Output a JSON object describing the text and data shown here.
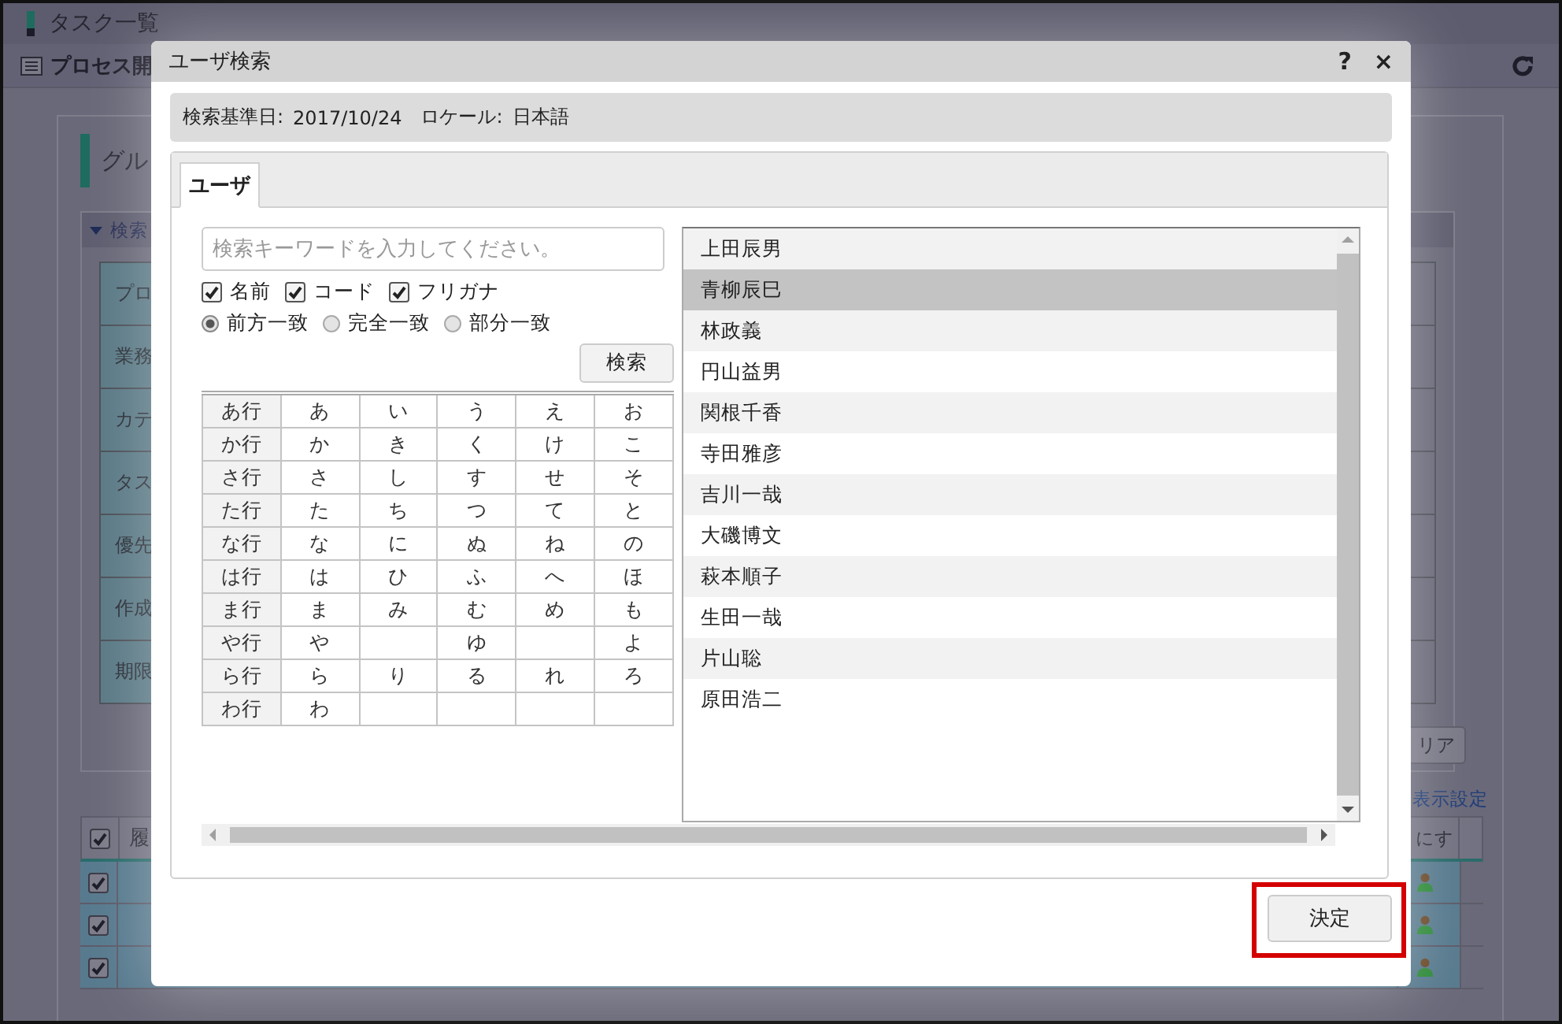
{
  "background_page": {
    "title": "タスク一覧",
    "subtitle": "プロセス開",
    "section_title": "グル",
    "search_header": "検索",
    "form_labels": [
      "プロ",
      "業務",
      "カテ",
      "タス",
      "優先",
      "作成",
      "期限"
    ],
    "clear_button": "リア",
    "display_settings_link": "表示設定",
    "table": {
      "header_checked": true,
      "columns": [
        "履",
        "にす"
      ],
      "rows": [
        {
          "checked": true
        },
        {
          "checked": true
        },
        {
          "checked": true
        }
      ]
    }
  },
  "dialog": {
    "title": "ユーザ検索",
    "help": "?",
    "close": "×",
    "info": [
      {
        "label": "検索基準日:",
        "value": "2017/10/24"
      },
      {
        "label": "ロケール:",
        "value": "日本語"
      }
    ],
    "tabs": [
      {
        "label": "ユーザ",
        "selected": true
      }
    ],
    "search": {
      "placeholder": "検索キーワードを入力してください。"
    },
    "targets": [
      {
        "label": "名前",
        "checked": true
      },
      {
        "label": "コード",
        "checked": true
      },
      {
        "label": "フリガナ",
        "checked": true
      }
    ],
    "match_modes": [
      {
        "label": "前方一致",
        "selected": true
      },
      {
        "label": "完全一致",
        "selected": false
      },
      {
        "label": "部分一致",
        "selected": false
      }
    ],
    "search_button": "検索",
    "kana_rows": [
      {
        "head": "あ行",
        "a": "あ",
        "i": "い",
        "u": "う",
        "e": "え",
        "o": "お"
      },
      {
        "head": "か行",
        "a": "か",
        "i": "き",
        "u": "く",
        "e": "け",
        "o": "こ"
      },
      {
        "head": "さ行",
        "a": "さ",
        "i": "し",
        "u": "す",
        "e": "せ",
        "o": "そ"
      },
      {
        "head": "た行",
        "a": "た",
        "i": "ち",
        "u": "つ",
        "e": "て",
        "o": "と"
      },
      {
        "head": "な行",
        "a": "な",
        "i": "に",
        "u": "ぬ",
        "e": "ね",
        "o": "の"
      },
      {
        "head": "は行",
        "a": "は",
        "i": "ひ",
        "u": "ふ",
        "e": "へ",
        "o": "ほ"
      },
      {
        "head": "ま行",
        "a": "ま",
        "i": "み",
        "u": "む",
        "e": "め",
        "o": "も"
      },
      {
        "head": "や行",
        "a": "や",
        "u": "ゆ",
        "o": "よ"
      },
      {
        "head": "ら行",
        "a": "ら",
        "i": "り",
        "u": "る",
        "e": "れ",
        "o": "ろ"
      },
      {
        "head": "わ行",
        "a": "わ"
      }
    ],
    "users": [
      {
        "name": "上田辰男",
        "selected": false
      },
      {
        "name": "青柳辰巳",
        "selected": true
      },
      {
        "name": "林政義",
        "selected": false
      },
      {
        "name": "円山益男",
        "selected": false
      },
      {
        "name": "関根千香",
        "selected": false
      },
      {
        "name": "寺田雅彦",
        "selected": false
      },
      {
        "name": "吉川一哉",
        "selected": false
      },
      {
        "name": "大磯博文",
        "selected": false
      },
      {
        "name": "萩本順子",
        "selected": false
      },
      {
        "name": "生田一哉",
        "selected": false
      },
      {
        "name": "片山聡",
        "selected": false
      },
      {
        "name": "原田浩二",
        "selected": false
      }
    ],
    "confirm_button": {
      "label": "決定",
      "highlighted": true
    }
  }
}
